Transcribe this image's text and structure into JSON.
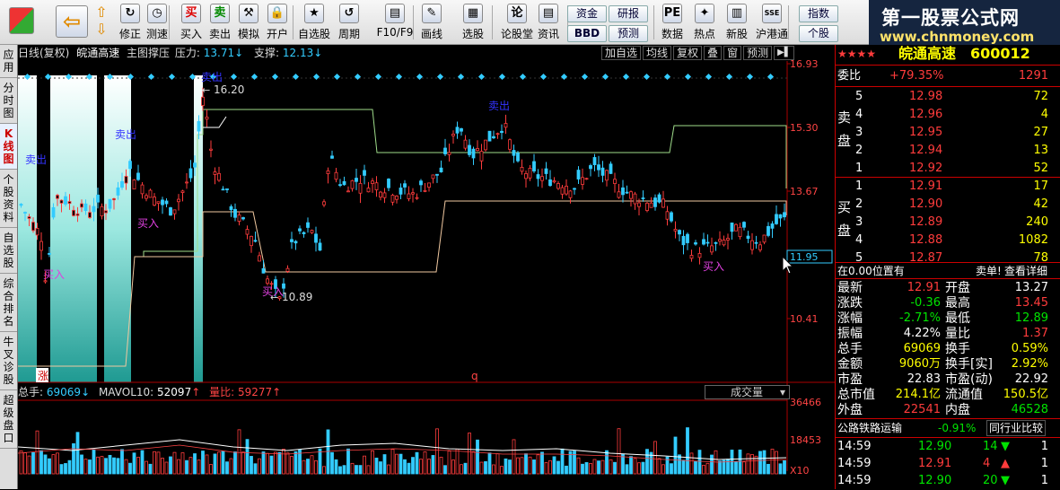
{
  "toolbar": {
    "buttons": [
      {
        "name": "back",
        "label": ""
      },
      {
        "name": "modify",
        "label": "修正"
      },
      {
        "name": "speed",
        "label": "测速"
      },
      {
        "name": "buy",
        "label": "买入"
      },
      {
        "name": "sell",
        "label": "卖出"
      },
      {
        "name": "simulate",
        "label": "模拟"
      },
      {
        "name": "open",
        "label": "开户"
      },
      {
        "name": "watchlist",
        "label": "自选股"
      },
      {
        "name": "period",
        "label": "周期"
      },
      {
        "name": "f10",
        "label": "F10/F9"
      },
      {
        "name": "draw",
        "label": "画线"
      },
      {
        "name": "pick",
        "label": "选股"
      },
      {
        "name": "forum",
        "label": "论股堂"
      },
      {
        "name": "info",
        "label": "资讯"
      },
      {
        "name": "data",
        "label": "数据"
      },
      {
        "name": "hot",
        "label": "热点"
      },
      {
        "name": "newstock",
        "label": "新股"
      },
      {
        "name": "hk",
        "label": "沪港通"
      }
    ],
    "small_buttons": [
      "资金",
      "研报",
      "BBD",
      "预测",
      "指数",
      "个股"
    ],
    "icon_glyphs": {
      "modify": "↻",
      "speed": "◷",
      "buy": "买",
      "sell": "卖",
      "simulate": "⚒",
      "open": "🔒",
      "watchlist": "★",
      "period": "↺",
      "f10": "▤",
      "draw": "✎",
      "pick": "▦",
      "forum": "论",
      "info": "▤",
      "data": "PE",
      "hot": "✦",
      "newstock": "▥",
      "hk": "SSE"
    }
  },
  "logo": {
    "line1": "第一股票公式网",
    "line2": "www.chnmoney.com"
  },
  "sidebar": [
    "应用",
    "分时图",
    "K线图",
    "个股资料",
    "自选股",
    "综合排名",
    "牛叉诊股",
    "超级盘口"
  ],
  "chart": {
    "title": "日线(复权)",
    "stock_name": "皖通高速",
    "indicator": "主图撑压",
    "pressure_label": "压力:",
    "pressure_value": "13.71",
    "support_label": "支撑:",
    "support_value": "12.13",
    "right_buttons": [
      "加自选",
      "均线",
      "复权",
      "叠",
      "窗",
      "预测"
    ],
    "price_ticks": [
      "16.93",
      "15.30",
      "13.67",
      "11.95",
      "10.41"
    ],
    "high_label": "16.20",
    "low_label": "10.89",
    "signals": [
      {
        "t": "卖出"
      },
      {
        "t": "卖出"
      },
      {
        "t": "卖出"
      },
      {
        "t": "卖出"
      },
      {
        "t": "买入"
      },
      {
        "t": "买入"
      },
      {
        "t": "买入"
      },
      {
        "t": "买入"
      }
    ],
    "zhang_label": "涨",
    "q_label": "q"
  },
  "volume": {
    "total_label": "总手:",
    "total_value": "69069",
    "mavol_label": "MAVOL10:",
    "mavol_value": "52097",
    "ratio_label": "量比:",
    "ratio_value": "59277",
    "select_label": "成交量",
    "ticks": [
      "36466",
      "18453",
      "X10"
    ]
  },
  "quote": {
    "header_stars": "★★★★",
    "name": "皖通高速",
    "code": "600012",
    "weibi_label": "委比",
    "weibi_value": "+79.35%",
    "weibi_diff": "1291",
    "sell_label": "卖盘",
    "buy_label": "买盘",
    "sells": [
      {
        "n": "5",
        "p": "12.98",
        "v": "72"
      },
      {
        "n": "4",
        "p": "12.96",
        "v": "4"
      },
      {
        "n": "3",
        "p": "12.95",
        "v": "27"
      },
      {
        "n": "2",
        "p": "12.94",
        "v": "13"
      },
      {
        "n": "1",
        "p": "12.92",
        "v": "52"
      }
    ],
    "buys": [
      {
        "n": "1",
        "p": "12.91",
        "v": "17"
      },
      {
        "n": "2",
        "p": "12.90",
        "v": "42"
      },
      {
        "n": "3",
        "p": "12.89",
        "v": "240"
      },
      {
        "n": "4",
        "p": "12.88",
        "v": "1082"
      },
      {
        "n": "5",
        "p": "12.87",
        "v": "78"
      }
    ],
    "position_text": "在0.00位置有",
    "sellorder_text": "卖单!",
    "detail_text": "查看详细",
    "stats": [
      {
        "l1": "最新",
        "v1": "12.91",
        "c1": "red",
        "l2": "开盘",
        "v2": "13.27",
        "c2": "wh"
      },
      {
        "l1": "涨跌",
        "v1": "-0.36",
        "c1": "green",
        "l2": "最高",
        "v2": "13.45",
        "c2": "red"
      },
      {
        "l1": "涨幅",
        "v1": "-2.71%",
        "c1": "green",
        "l2": "最低",
        "v2": "12.89",
        "c2": "green"
      },
      {
        "l1": "振幅",
        "v1": "4.22%",
        "c1": "wh",
        "l2": "量比",
        "v2": "1.37",
        "c2": "red"
      },
      {
        "l1": "总手",
        "v1": "69069",
        "c1": "yel",
        "l2": "换手",
        "v2": "0.59%",
        "c2": "yel"
      },
      {
        "l1": "金额",
        "v1": "9060万",
        "c1": "yel",
        "l2": "换手[实]",
        "v2": "2.92%",
        "c2": "yel"
      },
      {
        "l1": "市盈",
        "v1": "22.83",
        "c1": "wh",
        "l2": "市盈(动)",
        "v2": "22.92",
        "c2": "wh"
      },
      {
        "l1": "总市值",
        "v1": "214.1亿",
        "c1": "yel",
        "l2": "流通值",
        "v2": "150.5亿",
        "c2": "yel"
      },
      {
        "l1": "外盘",
        "v1": "22541",
        "c1": "red",
        "l2": "内盘",
        "v2": "46528",
        "c2": "green"
      }
    ],
    "industry": "公路铁路运输",
    "industry_change": "-0.91%",
    "compare": "同行业比较",
    "ticks": [
      {
        "t": "14:59",
        "p": "12.90",
        "v": "14",
        "d": "down",
        "n": "1"
      },
      {
        "t": "14:59",
        "p": "12.91",
        "v": "4",
        "d": "up",
        "n": "1"
      },
      {
        "t": "14:59",
        "p": "12.90",
        "v": "20",
        "d": "down",
        "n": "1"
      }
    ]
  }
}
